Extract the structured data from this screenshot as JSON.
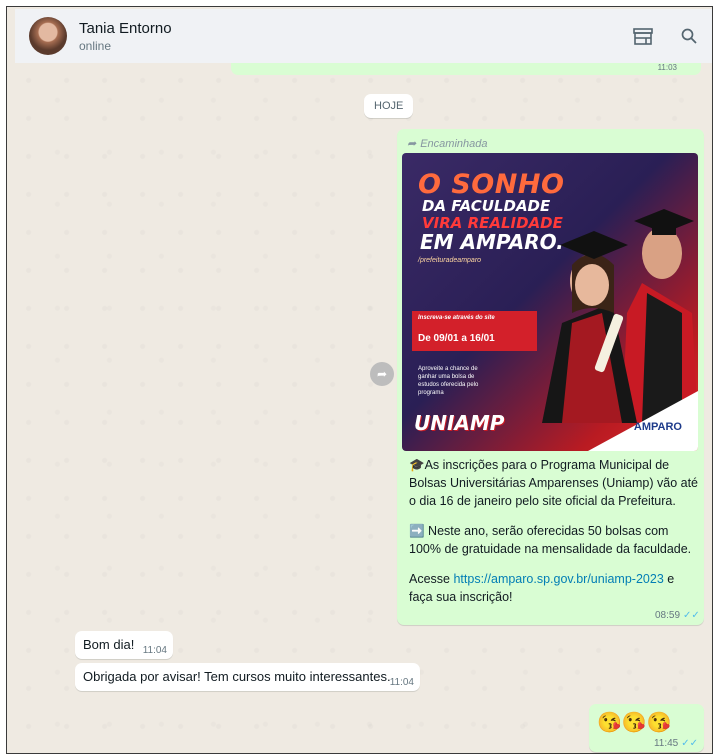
{
  "contact": {
    "name": "Tania Entorno",
    "status": "online"
  },
  "header_icons": [
    "storefront-icon",
    "search-icon"
  ],
  "date_chip": "HOJE",
  "forwarded_message": {
    "forwarded_label": "Encaminhada",
    "poster": {
      "title_line1": "O SONHO",
      "title_line2": "DA FACULDADE",
      "title_line3": "VIRA REALIDADE",
      "title_line4": "EM AMPARO.",
      "handle": "/prefeituradeamparo",
      "box_line1": "Inscreva-se através do site",
      "box_dates": "De 09/01 a 16/01",
      "small_text": "Aproveite a chance de ganhar uma bolsa de estudos oferecida pelo programa",
      "uniamp_logo": "UNIAMP",
      "amparo_logo": "AMPARO"
    },
    "paragraph1": "🎓As inscrições para o Programa Municipal de Bolsas Universitárias Amparenses (Uniamp) vão até o dia 16 de janeiro pelo site oficial da Prefeitura.",
    "paragraph2": "➡️ Neste ano, serão oferecidas 50 bolsas com 100% de gratuidade na mensalidade da faculdade.",
    "paragraph3_prefix": "Acesse ",
    "link": "https://amparo.sp.gov.br/uniamp-2023",
    "paragraph3_suffix": " e faça sua inscrição!",
    "time": "08:59"
  },
  "incoming": [
    {
      "text": "Bom dia!",
      "time": "11:04"
    },
    {
      "text": "Obrigada por avisar! Tem cursos muito interessantes.",
      "time": "11:04"
    }
  ],
  "outgoing_emoji": {
    "emoji": "😘😘😘",
    "time": "11:45"
  },
  "top_partial_time": "11:03",
  "colors": {
    "outgoing_bubble": "#d9fdd3",
    "incoming_bubble": "#ffffff",
    "chat_background": "#efeae2",
    "read_ticks": "#53bdeb",
    "link": "#027eb5"
  }
}
